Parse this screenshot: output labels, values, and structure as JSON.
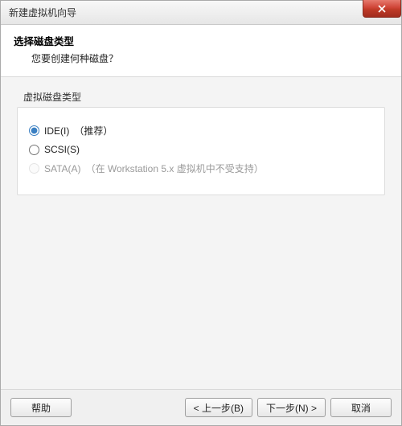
{
  "window": {
    "title": "新建虚拟机向导"
  },
  "header": {
    "title": "选择磁盘类型",
    "subtitle": "您要创建何种磁盘？"
  },
  "group": {
    "legend": "虚拟磁盘类型",
    "options": [
      {
        "label": "IDE(I)",
        "note": "（推荐）",
        "checked": true,
        "disabled": false
      },
      {
        "label": "SCSI(S)",
        "note": "",
        "checked": false,
        "disabled": false
      },
      {
        "label": "SATA(A)",
        "note": "（在 Workstation 5.x 虚拟机中不受支持）",
        "checked": false,
        "disabled": true
      }
    ]
  },
  "footer": {
    "help": "帮助",
    "back": "< 上一步(B)",
    "next": "下一步(N) >",
    "cancel": "取消"
  }
}
